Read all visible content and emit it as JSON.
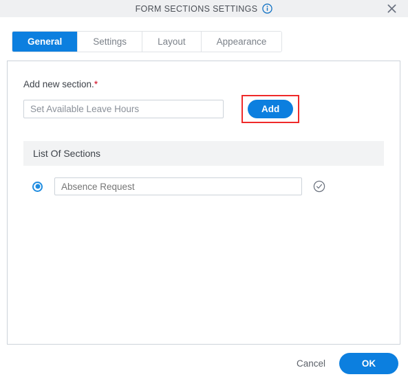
{
  "window": {
    "title": "FORM SECTIONS SETTINGS",
    "info_icon": "info-circle-icon",
    "close_icon": "close-icon"
  },
  "tabs": [
    {
      "label": "General",
      "active": true
    },
    {
      "label": "Settings",
      "active": false
    },
    {
      "label": "Layout",
      "active": false
    },
    {
      "label": "Appearance",
      "active": false
    }
  ],
  "form": {
    "add_section_label": "Add new section.",
    "required_marker": "*",
    "new_section_value": "Set Available Leave Hours",
    "new_section_placeholder": "Set Available Leave Hours",
    "add_button_label": "Add",
    "add_button_highlighted": true,
    "list_header": "List Of Sections",
    "sections": [
      {
        "name": "Absence Request",
        "selected": true,
        "status_icon": "check-circle-icon"
      }
    ]
  },
  "footer": {
    "cancel_label": "Cancel",
    "ok_label": "OK"
  },
  "colors": {
    "accent": "#0c7fdf",
    "highlight": "#ef2929",
    "titlebar_bg": "#eff0f2",
    "list_header_bg": "#f2f3f4",
    "required": "#d0021b"
  }
}
